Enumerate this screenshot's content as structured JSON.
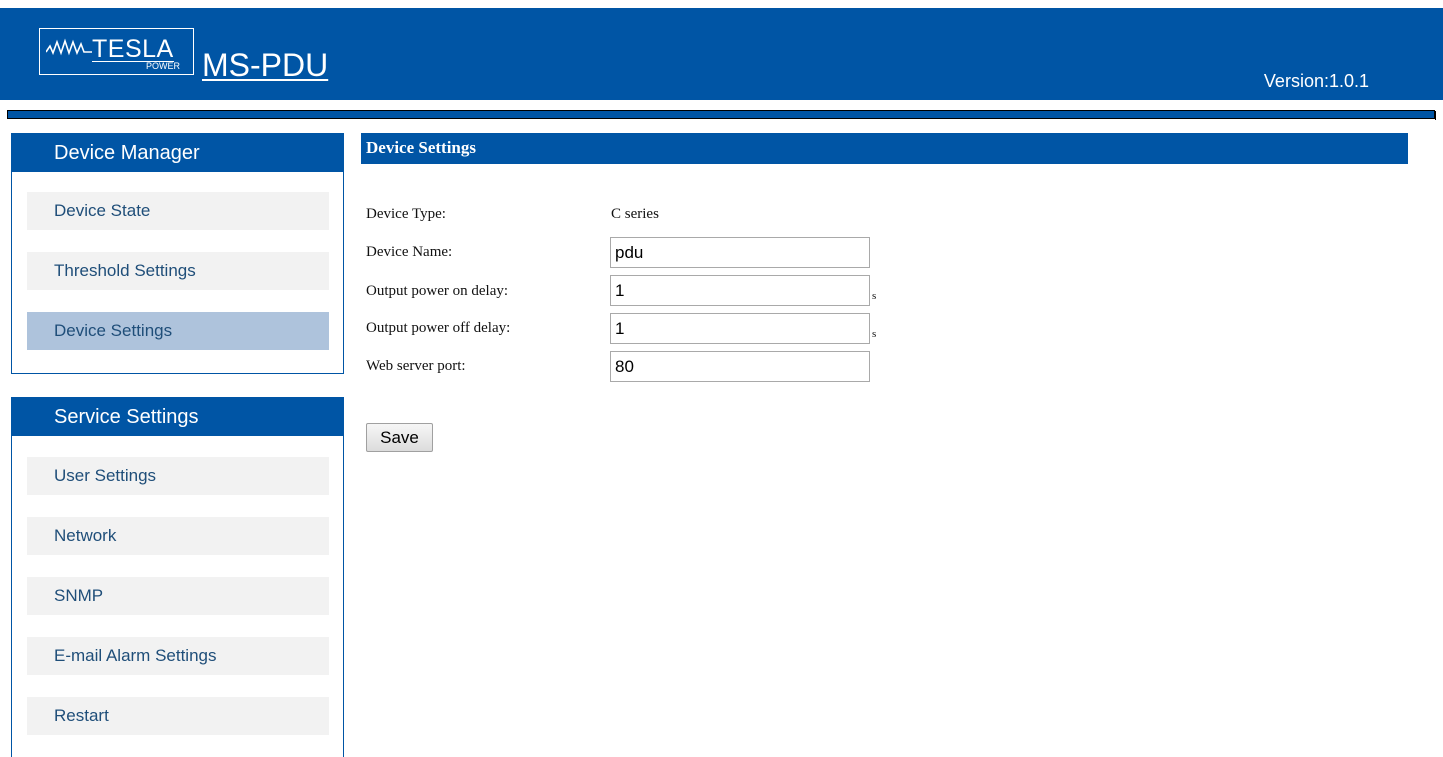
{
  "header": {
    "logo_text": "TESLA",
    "logo_subtext": "POWER",
    "product_name": "MS-PDU",
    "version": "Version:1.0.1"
  },
  "sidebar": {
    "device_manager": {
      "title": "Device Manager",
      "items": [
        {
          "label": "Device State",
          "active": false
        },
        {
          "label": "Threshold Settings",
          "active": false
        },
        {
          "label": "Device Settings",
          "active": true
        }
      ]
    },
    "service_settings": {
      "title": "Service Settings",
      "items": [
        {
          "label": "User Settings",
          "active": false
        },
        {
          "label": "Network",
          "active": false
        },
        {
          "label": "SNMP",
          "active": false
        },
        {
          "label": "E-mail Alarm Settings",
          "active": false
        },
        {
          "label": "Restart",
          "active": false
        }
      ]
    }
  },
  "main": {
    "title": "Device Settings",
    "device_type": {
      "label": "Device Type:",
      "value": "C series"
    },
    "device_name": {
      "label": "Device Name:",
      "value": "pdu"
    },
    "power_on_delay": {
      "label": "Output power on delay:",
      "value": "1",
      "unit": "s"
    },
    "power_off_delay": {
      "label": "Output power off delay:",
      "value": "1",
      "unit": "s"
    },
    "web_server_port": {
      "label": "Web server port:",
      "value": "80"
    },
    "save_label": "Save"
  },
  "colors": {
    "brand_blue": "#0055a5",
    "nav_item_bg": "#f2f2f2",
    "nav_active_bg": "#aec3dc",
    "nav_text": "#1f4e79"
  }
}
